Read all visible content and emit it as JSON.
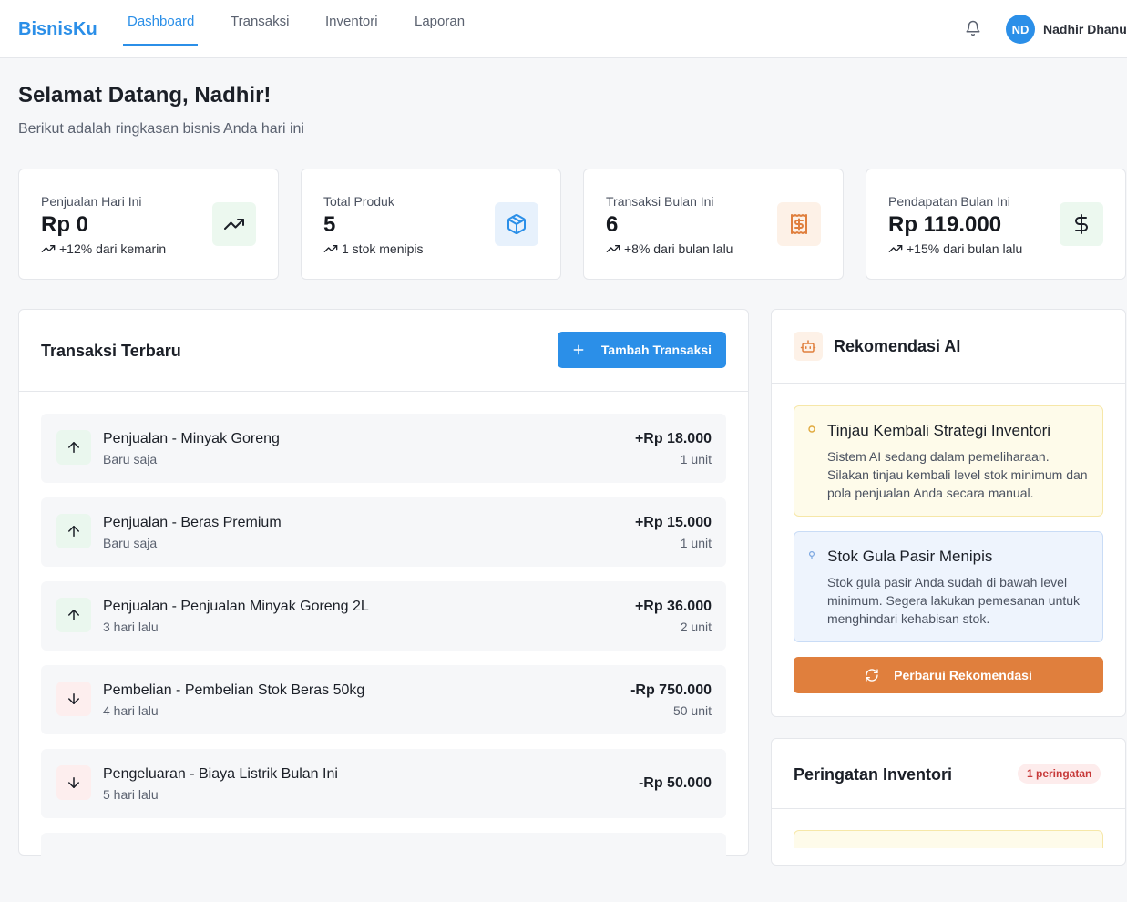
{
  "brand": "BisnisKu",
  "nav": {
    "tabs": [
      {
        "label": "Dashboard",
        "active": true
      },
      {
        "label": "Transaksi",
        "active": false
      },
      {
        "label": "Inventori",
        "active": false
      },
      {
        "label": "Laporan",
        "active": false
      }
    ],
    "bell_icon": "bell-icon",
    "user": {
      "initials": "ND",
      "name": "Nadhir Dhanu"
    }
  },
  "header": {
    "title": "Selamat Datang, Nadhir!",
    "subtitle": "Berikut adalah ringkasan bisnis Anda hari ini"
  },
  "stats": [
    {
      "label": "Penjualan Hari Ini",
      "value": "Rp 0",
      "change": "+12% dari kemarin",
      "icon": "trending-up-icon",
      "tile_color": "#ecf8ef"
    },
    {
      "label": "Total Produk",
      "value": "5",
      "change": "1 stok menipis",
      "icon": "box-icon",
      "tile_color": "#e7f1fc"
    },
    {
      "label": "Transaksi Bulan Ini",
      "value": "6",
      "change": "+8% dari bulan lalu",
      "icon": "receipt-icon",
      "tile_color": "#fdf1e7"
    },
    {
      "label": "Pendapatan Bulan Ini",
      "value": "Rp 119.000",
      "change": "+15% dari bulan lalu",
      "icon": "dollar-icon",
      "tile_color": "#ecf8ef"
    }
  ],
  "transactions_panel": {
    "title": "Transaksi Terbaru",
    "add_button": "Tambah Transaksi",
    "items": [
      {
        "name": "Penjualan - Minyak Goreng",
        "time": "Baru saja",
        "amount": "+Rp 18.000",
        "unit": "1 unit",
        "direction": "up"
      },
      {
        "name": "Penjualan - Beras Premium",
        "time": "Baru saja",
        "amount": "+Rp 15.000",
        "unit": "1 unit",
        "direction": "up"
      },
      {
        "name": "Penjualan - Penjualan Minyak Goreng 2L",
        "time": "3 hari lalu",
        "amount": "+Rp 36.000",
        "unit": "2 unit",
        "direction": "up"
      },
      {
        "name": "Pembelian - Pembelian Stok Beras 50kg",
        "time": "4 hari lalu",
        "amount": "-Rp 750.000",
        "unit": "50 unit",
        "direction": "down"
      },
      {
        "name": "Pengeluaran - Biaya Listrik Bulan Ini",
        "time": "5 hari lalu",
        "amount": "-Rp 50.000",
        "unit": "",
        "direction": "down"
      }
    ]
  },
  "ai_panel": {
    "title": "Rekomendasi AI",
    "icon": "robot-icon",
    "recommendations": [
      {
        "title": "Tinjau Kembali Strategi Inventori",
        "text": "Sistem AI sedang dalam pemeliharaan. Silakan tinjau kembali level stok minimum dan pola penjualan Anda secara manual.",
        "kind": "warning"
      },
      {
        "title": "Stok Gula Pasir Menipis",
        "text": "Stok gula pasir Anda sudah di bawah level minimum. Segera lakukan pemesanan untuk menghindari kehabisan stok.",
        "kind": "info"
      }
    ],
    "refresh_button": "Perbarui Rekomendasi"
  },
  "inventory_panel": {
    "title": "Peringatan Inventori",
    "badge": "1 peringatan"
  },
  "colors": {
    "primary": "#2b8fe8",
    "accent_orange": "#e07f3d",
    "danger": "#c73a3a"
  }
}
